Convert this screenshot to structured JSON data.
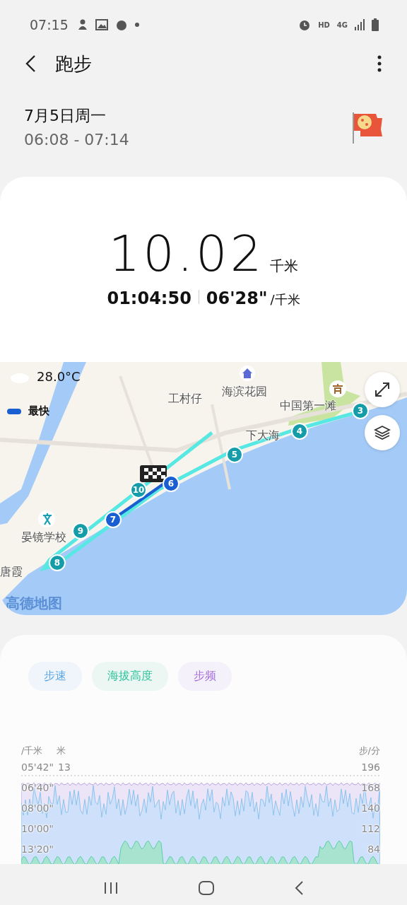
{
  "status_bar": {
    "time": "07:15",
    "network": "4G",
    "hd": "HD"
  },
  "header": {
    "title": "跑步"
  },
  "session": {
    "date": "7月5日周一",
    "time_range": "06:08 - 07:14"
  },
  "summary": {
    "distance": "10.02",
    "distance_unit": "千米",
    "duration": "01:04:50",
    "pace": "06'28\"",
    "pace_unit": "/千米"
  },
  "map": {
    "temperature": "28.0°C",
    "legend": "最快",
    "attribution": "高德地图",
    "places": [
      {
        "label": "海滨花园"
      },
      {
        "label": "工村仔"
      },
      {
        "label": "下大海"
      },
      {
        "label": "中国第一滩"
      },
      {
        "label": "晏镜学校"
      },
      {
        "label": "唐霞"
      }
    ],
    "km_markers": [
      {
        "label": "3",
        "fastest": false
      },
      {
        "label": "4",
        "fastest": false
      },
      {
        "label": "5",
        "fastest": false
      },
      {
        "label": "6",
        "fastest": true
      },
      {
        "label": "7",
        "fastest": true
      },
      {
        "label": "8",
        "fastest": false
      },
      {
        "label": "9",
        "fastest": false
      },
      {
        "label": "10",
        "fastest": false
      }
    ]
  },
  "chart_tabs": [
    {
      "label": "步速",
      "color": "#5aa6e6"
    },
    {
      "label": "海拔高度",
      "color": "#2fc39a"
    },
    {
      "label": "步频",
      "color": "#a66ee0"
    }
  ],
  "chart": {
    "left_unit_1": "/千米",
    "left_unit_2": "米",
    "right_unit": "步/分",
    "rows": [
      {
        "pace": "05'42\"",
        "altitude": "13",
        "cadence": "196"
      },
      {
        "pace": "06'40\"",
        "cadence": "168"
      },
      {
        "pace": "08'00\"",
        "cadence": "140"
      },
      {
        "pace": "10'00\"",
        "cadence": "112"
      },
      {
        "pace": "13'20\"",
        "cadence": "84"
      }
    ]
  }
}
